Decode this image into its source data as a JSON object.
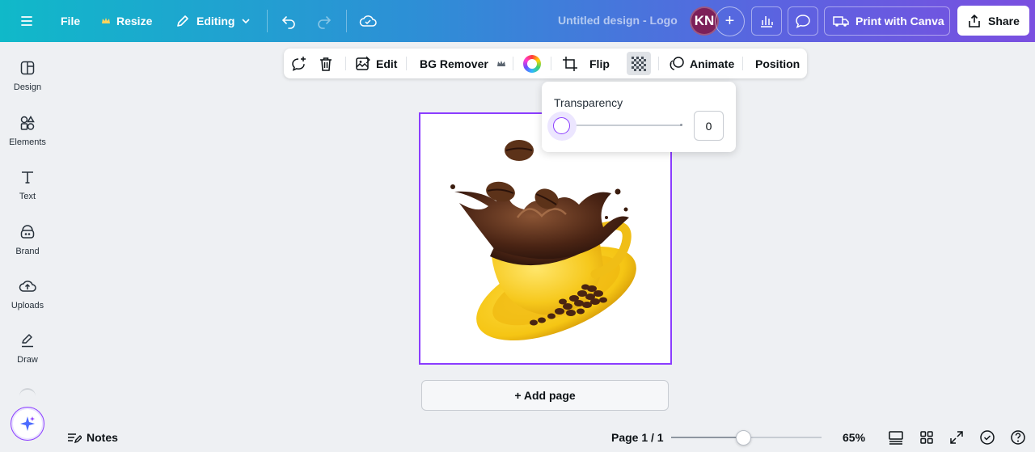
{
  "topbar": {
    "file_label": "File",
    "resize_label": "Resize",
    "editing_label": "Editing",
    "design_title": "Untitled design - Logo",
    "avatar_initials": "KN",
    "print_label": "Print with Canva",
    "share_label": "Share",
    "accent_gradient": [
      "#10b9c9",
      "#5b63e0",
      "#7a4fe0"
    ]
  },
  "sidebar": {
    "items": [
      {
        "label": "Design",
        "icon": "design-icon"
      },
      {
        "label": "Elements",
        "icon": "elements-icon"
      },
      {
        "label": "Text",
        "icon": "text-icon"
      },
      {
        "label": "Brand",
        "icon": "brand-icon"
      },
      {
        "label": "Uploads",
        "icon": "uploads-icon"
      },
      {
        "label": "Draw",
        "icon": "draw-icon"
      }
    ]
  },
  "context_toolbar": {
    "edit_label": "Edit",
    "bg_remover_label": "BG Remover",
    "flip_label": "Flip",
    "animate_label": "Animate",
    "position_label": "Position"
  },
  "canvas": {
    "image": "coffee-cup-splash",
    "selection_color": "#8b3dff",
    "add_page_label": "+ Add page"
  },
  "transparency_popover": {
    "title": "Transparency",
    "value": "0",
    "slider_fraction": 0.0
  },
  "bottom_bar": {
    "notes_label": "Notes",
    "page_indicator": "Page 1 / 1",
    "zoom_label": "65%",
    "zoom_fraction": 0.48
  }
}
